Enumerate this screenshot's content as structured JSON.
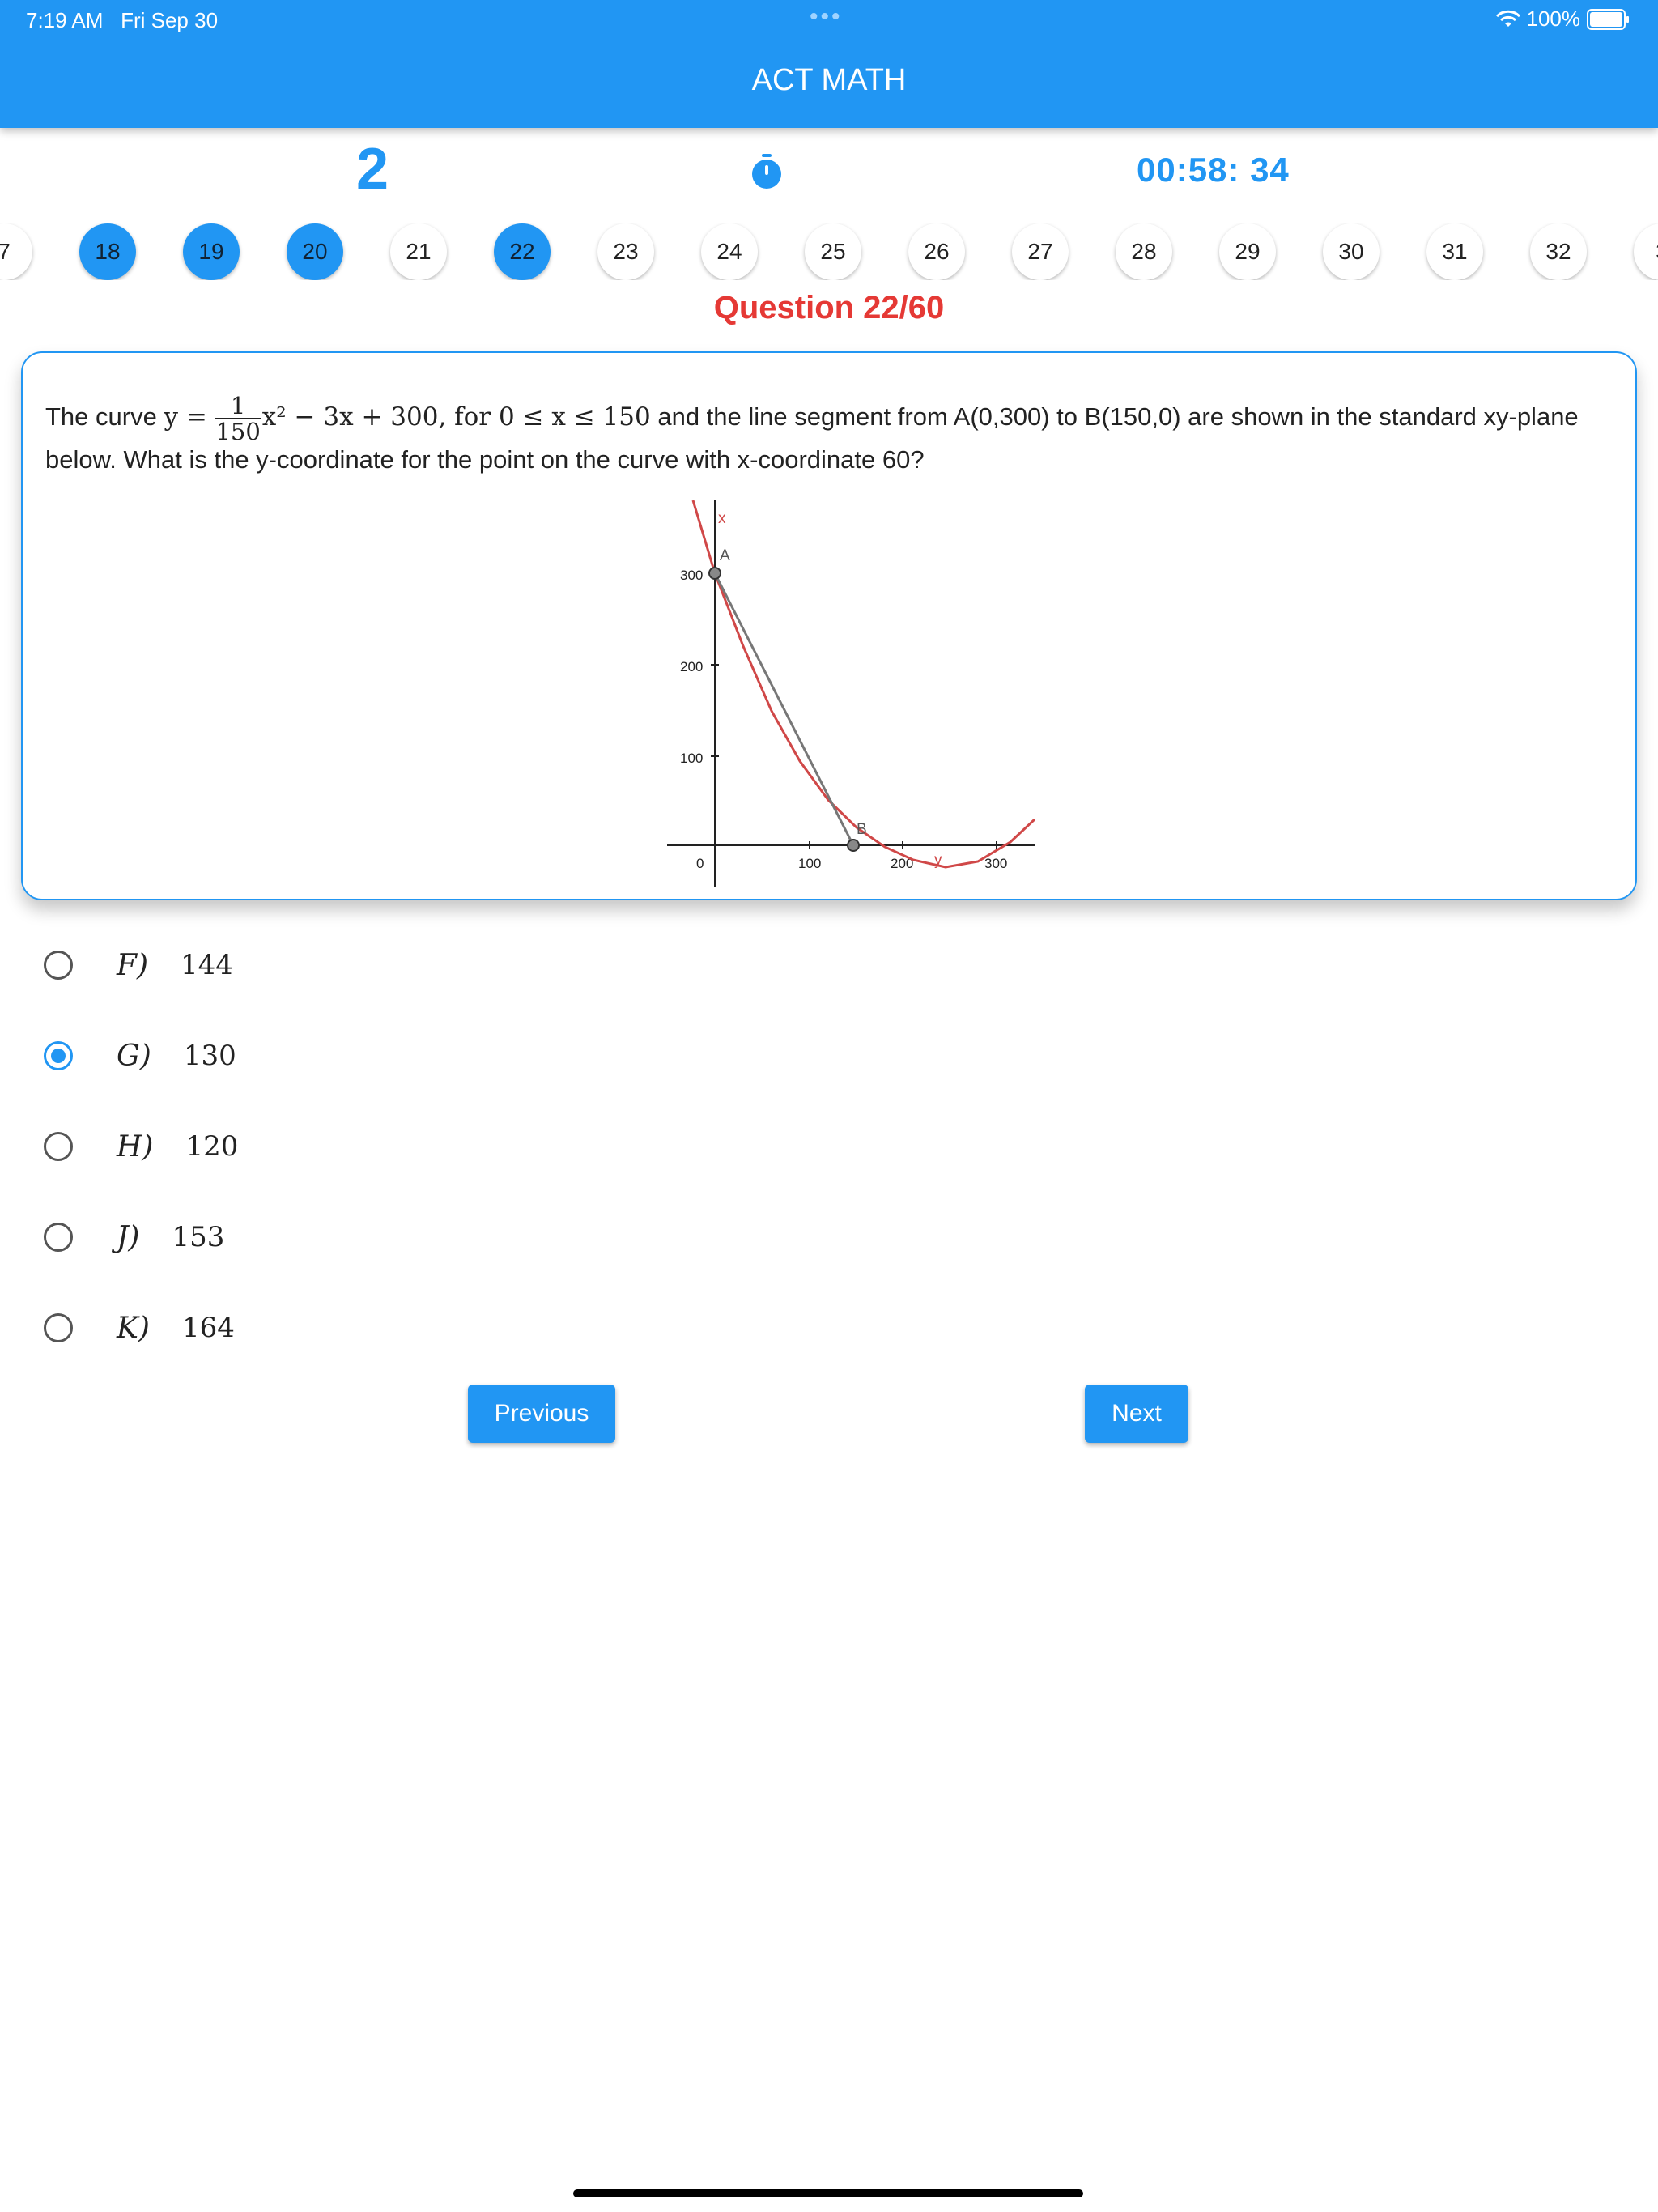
{
  "status_bar": {
    "time": "7:19 AM",
    "date": "Fri Sep 30",
    "dots": "•••",
    "battery": "100%"
  },
  "app": {
    "title": "ACT MATH"
  },
  "info": {
    "big_number": "2",
    "timer": "00:58: 34"
  },
  "question_numbers": [
    "7",
    "18",
    "19",
    "20",
    "21",
    "22",
    "23",
    "24",
    "25",
    "26",
    "27",
    "28",
    "29",
    "30",
    "31",
    "32",
    "3"
  ],
  "answered_numbers": [
    "18",
    "19",
    "20",
    "22"
  ],
  "question_label": "Question 22/60",
  "question": {
    "text_prefix": "The curve",
    "formula_lhs": "y =",
    "formula_num": "1",
    "formula_den": "150",
    "formula_rest": "x² − 3x + 300,  for 0 ≤ x ≤ 150",
    "text_suffix": "and the line segment from A(0,300) to B(150,0) are shown in the standard xy-plane below.  What is the y-coordinate for the point on the curve with x-coordinate 60?"
  },
  "graph": {
    "point_a": "A",
    "point_b": "B",
    "axis_x_label": "x",
    "axis_y_label": "y",
    "y_ticks": [
      "300",
      "200",
      "100"
    ],
    "x_ticks": [
      "0",
      "100",
      "200",
      "300"
    ]
  },
  "options": [
    {
      "letter": "F)",
      "value": "144",
      "selected": false
    },
    {
      "letter": "G)",
      "value": "130",
      "selected": true
    },
    {
      "letter": "H)",
      "value": "120",
      "selected": false
    },
    {
      "letter": "J)",
      "value": "153",
      "selected": false
    },
    {
      "letter": "K)",
      "value": "164",
      "selected": false
    }
  ],
  "buttons": {
    "previous": "Previous",
    "next": "Next"
  },
  "colors": {
    "primary": "#2196F3",
    "question_label": "#E53935",
    "curve": "#D04848",
    "segment": "#777777"
  }
}
